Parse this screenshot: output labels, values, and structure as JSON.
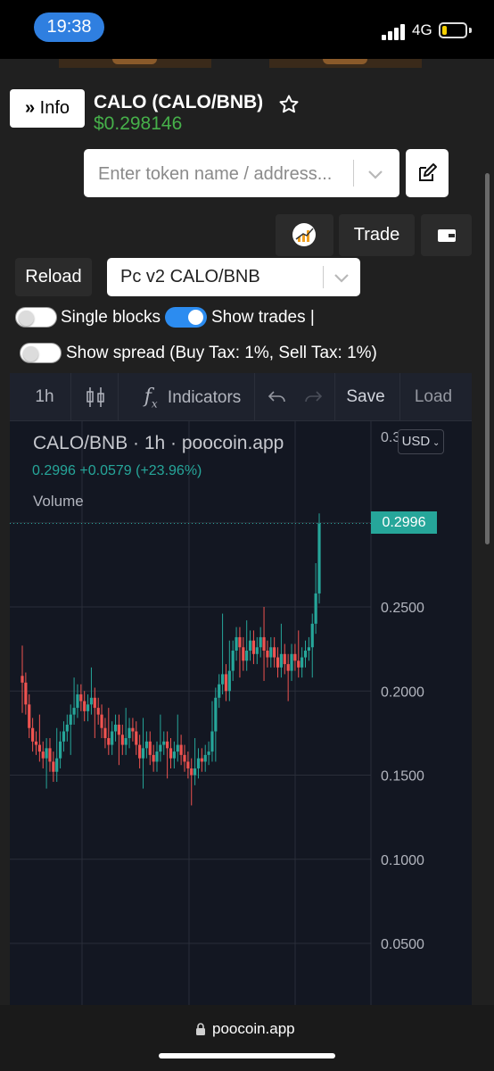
{
  "status_bar": {
    "time": "19:38",
    "network": "4G",
    "battery_level": 0.2
  },
  "header": {
    "info_label": "Info",
    "token_title": "CALO (CALO/BNB)",
    "token_price": "$0.298146"
  },
  "search": {
    "placeholder": "Enter token name / address..."
  },
  "actions": {
    "trade_label": "Trade",
    "reload_label": "Reload",
    "pair_value": "Pc v2 CALO/BNB"
  },
  "toggles": {
    "single_blocks": {
      "label": "Single blocks",
      "on": false
    },
    "show_trades": {
      "label": "Show trades |",
      "on": true
    },
    "show_spread": {
      "label": "Show spread (Buy Tax: 1%, Sell Tax: 1%)",
      "on": false
    }
  },
  "chart_toolbar": {
    "interval": "1h",
    "indicators_label": "Indicators",
    "save_label": "Save",
    "load_label": "Load"
  },
  "chart_legend": {
    "title": "CALO/BNB · 1h · poocoin.app",
    "values": "0.2996  +0.0579 (+23.96%)",
    "volume_label": "Volume",
    "currency": "USD",
    "last_price": "0.2996",
    "top_tick": "0.3"
  },
  "chart_data": {
    "type": "candlestick",
    "title": "CALO/BNB · 1h · poocoin.app",
    "yticks": [
      "0.2500",
      "0.2000",
      "0.1500",
      "0.1000",
      "0.0500"
    ],
    "ylim": [
      0.02,
      0.3
    ],
    "last_price": 0.2996,
    "up_color": "#26a69a",
    "down_color": "#ef5350",
    "grid": true,
    "closes": [
      0.205,
      0.192,
      0.178,
      0.17,
      0.168,
      0.164,
      0.16,
      0.166,
      0.158,
      0.152,
      0.16,
      0.17,
      0.176,
      0.18,
      0.186,
      0.19,
      0.198,
      0.194,
      0.188,
      0.192,
      0.196,
      0.19,
      0.186,
      0.178,
      0.172,
      0.168,
      0.176,
      0.18,
      0.174,
      0.168,
      0.172,
      0.178,
      0.176,
      0.168,
      0.16,
      0.166,
      0.17,
      0.162,
      0.158,
      0.164,
      0.168,
      0.17,
      0.166,
      0.16,
      0.164,
      0.168,
      0.162,
      0.158,
      0.154,
      0.15,
      0.154,
      0.16,
      0.158,
      0.162,
      0.164,
      0.176,
      0.196,
      0.204,
      0.21,
      0.2,
      0.212,
      0.224,
      0.232,
      0.226,
      0.218,
      0.224,
      0.23,
      0.222,
      0.226,
      0.232,
      0.224,
      0.22,
      0.226,
      0.22,
      0.214,
      0.222,
      0.216,
      0.212,
      0.222,
      0.218,
      0.214,
      0.22,
      0.224,
      0.226,
      0.24,
      0.258,
      0.2996
    ]
  },
  "url": "poocoin.app"
}
